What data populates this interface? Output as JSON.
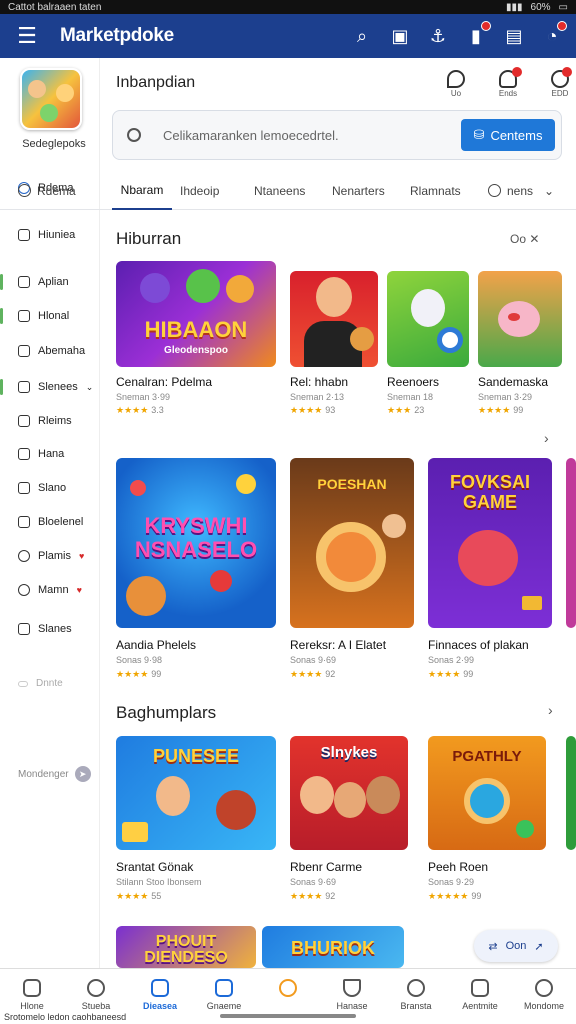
{
  "status": {
    "left": "Cattot balraaen taten",
    "right": "60%"
  },
  "topbar": {
    "brand": "Marketpdoke"
  },
  "sidebar": {
    "app_name": "Sedeglepoks",
    "items": [
      {
        "label": "Rdema"
      },
      {
        "label": "Hiuniea"
      },
      {
        "label": "Aplian"
      },
      {
        "label": "Hlonal"
      },
      {
        "label": "Abemaha"
      },
      {
        "label": "Slenees"
      },
      {
        "label": "Rleims"
      },
      {
        "label": "Hana"
      },
      {
        "label": "Slano"
      },
      {
        "label": "Bloelenel"
      },
      {
        "label": "Plamis"
      },
      {
        "label": "Mamn"
      },
      {
        "label": "Slanes"
      },
      {
        "label": "Dnnte"
      }
    ],
    "footer_label": "Mondenger"
  },
  "header": {
    "title": "Inbanpdian",
    "icons": [
      {
        "name": "map-pin-icon",
        "label": "Uo"
      },
      {
        "name": "cloud-icon",
        "label": "Ends"
      },
      {
        "name": "refresh-icon",
        "label": "EDD"
      }
    ]
  },
  "search": {
    "placeholder": "Celikamaranken lemoecedrtel.",
    "button": "Centems"
  },
  "tabs": [
    {
      "label": "Rdema"
    },
    {
      "label": "Nbaram"
    },
    {
      "label": "Ihdeoip"
    },
    {
      "label": "Ntaneens"
    },
    {
      "label": "Nenarters"
    },
    {
      "label": "Rlamnats"
    },
    {
      "label": "nens"
    }
  ],
  "sections": [
    {
      "title": "Hiburran",
      "controls": "Oo ✕",
      "items": [
        {
          "title": "Cenalran: Pdelma",
          "sub": "Sneman 3·99",
          "rating": "3.3",
          "art_text": "HIBAAON",
          "art_sub": "Gleodenspoo"
        },
        {
          "title": "Rel: hhabn",
          "sub": "Sneman 2·13",
          "rating": "93"
        },
        {
          "title": "Reenoers",
          "sub": "Sneman 18",
          "rating": "23"
        },
        {
          "title": "Sandemaska",
          "sub": "Sneman 3·29",
          "rating": "99"
        }
      ]
    },
    {
      "title": "",
      "items": [
        {
          "title": "Aandia Phelels",
          "sub": "Sonas 9·98",
          "rating": "99",
          "art_text": "KRYSWHI NSNASELO"
        },
        {
          "title": "Rereksr: A I Elatet",
          "sub": "Sonas 9·69",
          "rating": "92",
          "art_text": "POESHAN"
        },
        {
          "title": "Finnaces of plakan",
          "sub": "Sonas 2·99",
          "rating": "99",
          "art_text": "FOVKSAI GAME"
        }
      ]
    },
    {
      "title": "Baghumplars",
      "items": [
        {
          "title": "Srantat Gönak",
          "sub": "Stilann  Stoo Ibonsem",
          "rating": "55",
          "art_text": "PUNESEE"
        },
        {
          "title": "Rbenr Carme",
          "sub": "Sonas 9·69",
          "rating": "92",
          "art_text": "Slnykes"
        },
        {
          "title": "Peeh Roen",
          "sub": "Sonas 9·29",
          "rating": "99",
          "art_text": "PGATHLY"
        }
      ]
    },
    {
      "title": "",
      "items": [
        {
          "title": "",
          "art_text": "PHOUIT DIENDESO"
        },
        {
          "title": "",
          "art_text": "BHURIOK"
        }
      ]
    }
  ],
  "float_button": {
    "label": "Oon"
  },
  "bottom_nav": [
    {
      "label": "Hlone"
    },
    {
      "label": "Stueba"
    },
    {
      "label": "Dieasea"
    },
    {
      "label": "Gnaeme"
    },
    {
      "label": ""
    },
    {
      "label": "Hanase"
    },
    {
      "label": "Bransta"
    },
    {
      "label": "Aentmite"
    },
    {
      "label": "Mondome"
    }
  ],
  "bottom_caption": "Srotomelo ledon caohbaneesd",
  "colors": {
    "brand": "#1c3f8e",
    "accent": "#1f78d8",
    "star": "#f0a500"
  }
}
